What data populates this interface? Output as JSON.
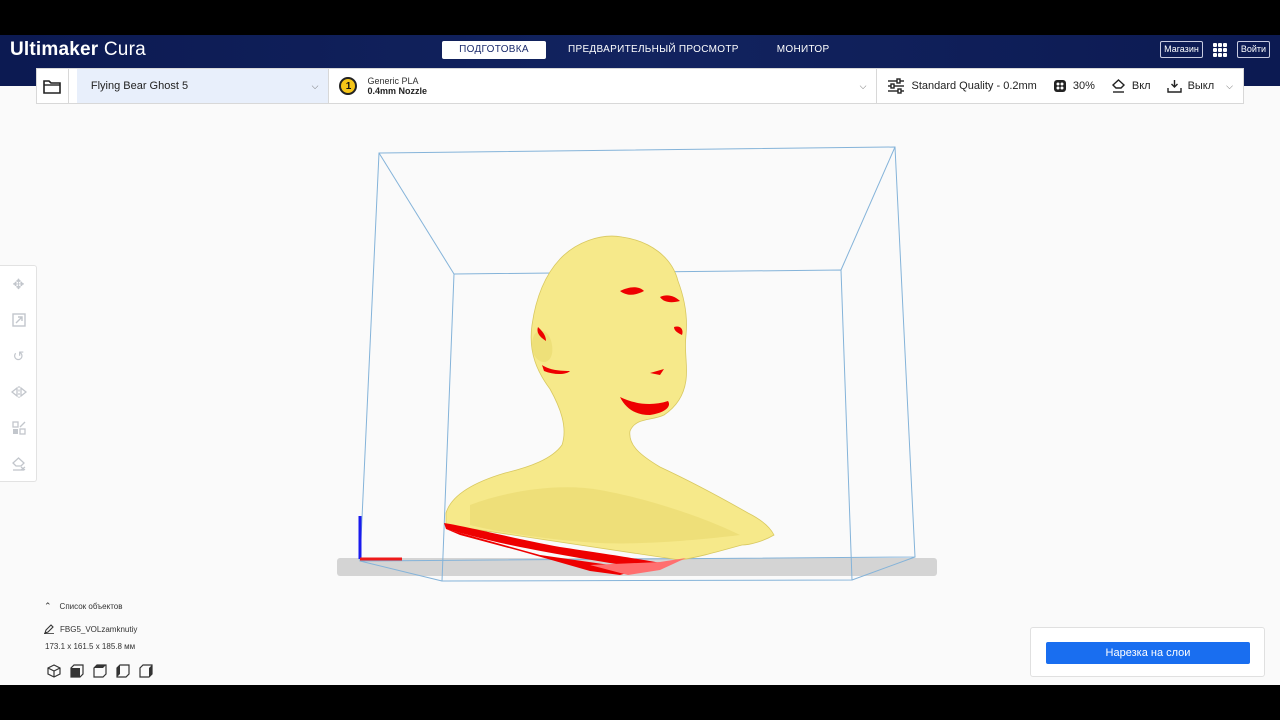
{
  "app": {
    "logo_bold": "Ultimaker",
    "logo_light": "Cura"
  },
  "stages": [
    {
      "label": "ПОДГОТОВКА",
      "active": true
    },
    {
      "label": "ПРЕДВАРИТЕЛЬНЫЙ ПРОСМОТР",
      "active": false
    },
    {
      "label": "МОНИТОР",
      "active": false
    }
  ],
  "header": {
    "marketplace_label": "Магазин",
    "login_label": "Войти",
    "apps_icon": "grid-icon"
  },
  "toolbar": {
    "open_icon": "folder-icon",
    "printer_name": "Flying Bear Ghost 5",
    "extruder_number": "1",
    "material_name": "Generic PLA",
    "nozzle": "0.4mm Nozzle",
    "quality": "Standard Quality - 0.2mm",
    "infill": "30%",
    "support": "Вкл",
    "adhesion": "Выкл"
  },
  "left_tools": [
    "move-icon",
    "scale-icon",
    "rotate-icon",
    "mirror-icon",
    "per-model-settings-icon",
    "support-blocker-icon"
  ],
  "objects": {
    "list_title": "Список объектов",
    "file_name": "FBG5_VOLzamknutiy",
    "dimensions": "173.1 x 161.5 x 185.8 мм",
    "view_icons": [
      "3d-view-icon",
      "front-view-icon",
      "top-view-icon",
      "left-view-icon",
      "right-view-icon"
    ]
  },
  "slice": {
    "button_label": "Нарезка на слои"
  },
  "colors": {
    "header_bg": "#0c1a52",
    "accent": "#196ef0",
    "model": "#f8ec8c",
    "overhang": "#ee0000",
    "build_volume": "#7fb0d8"
  }
}
